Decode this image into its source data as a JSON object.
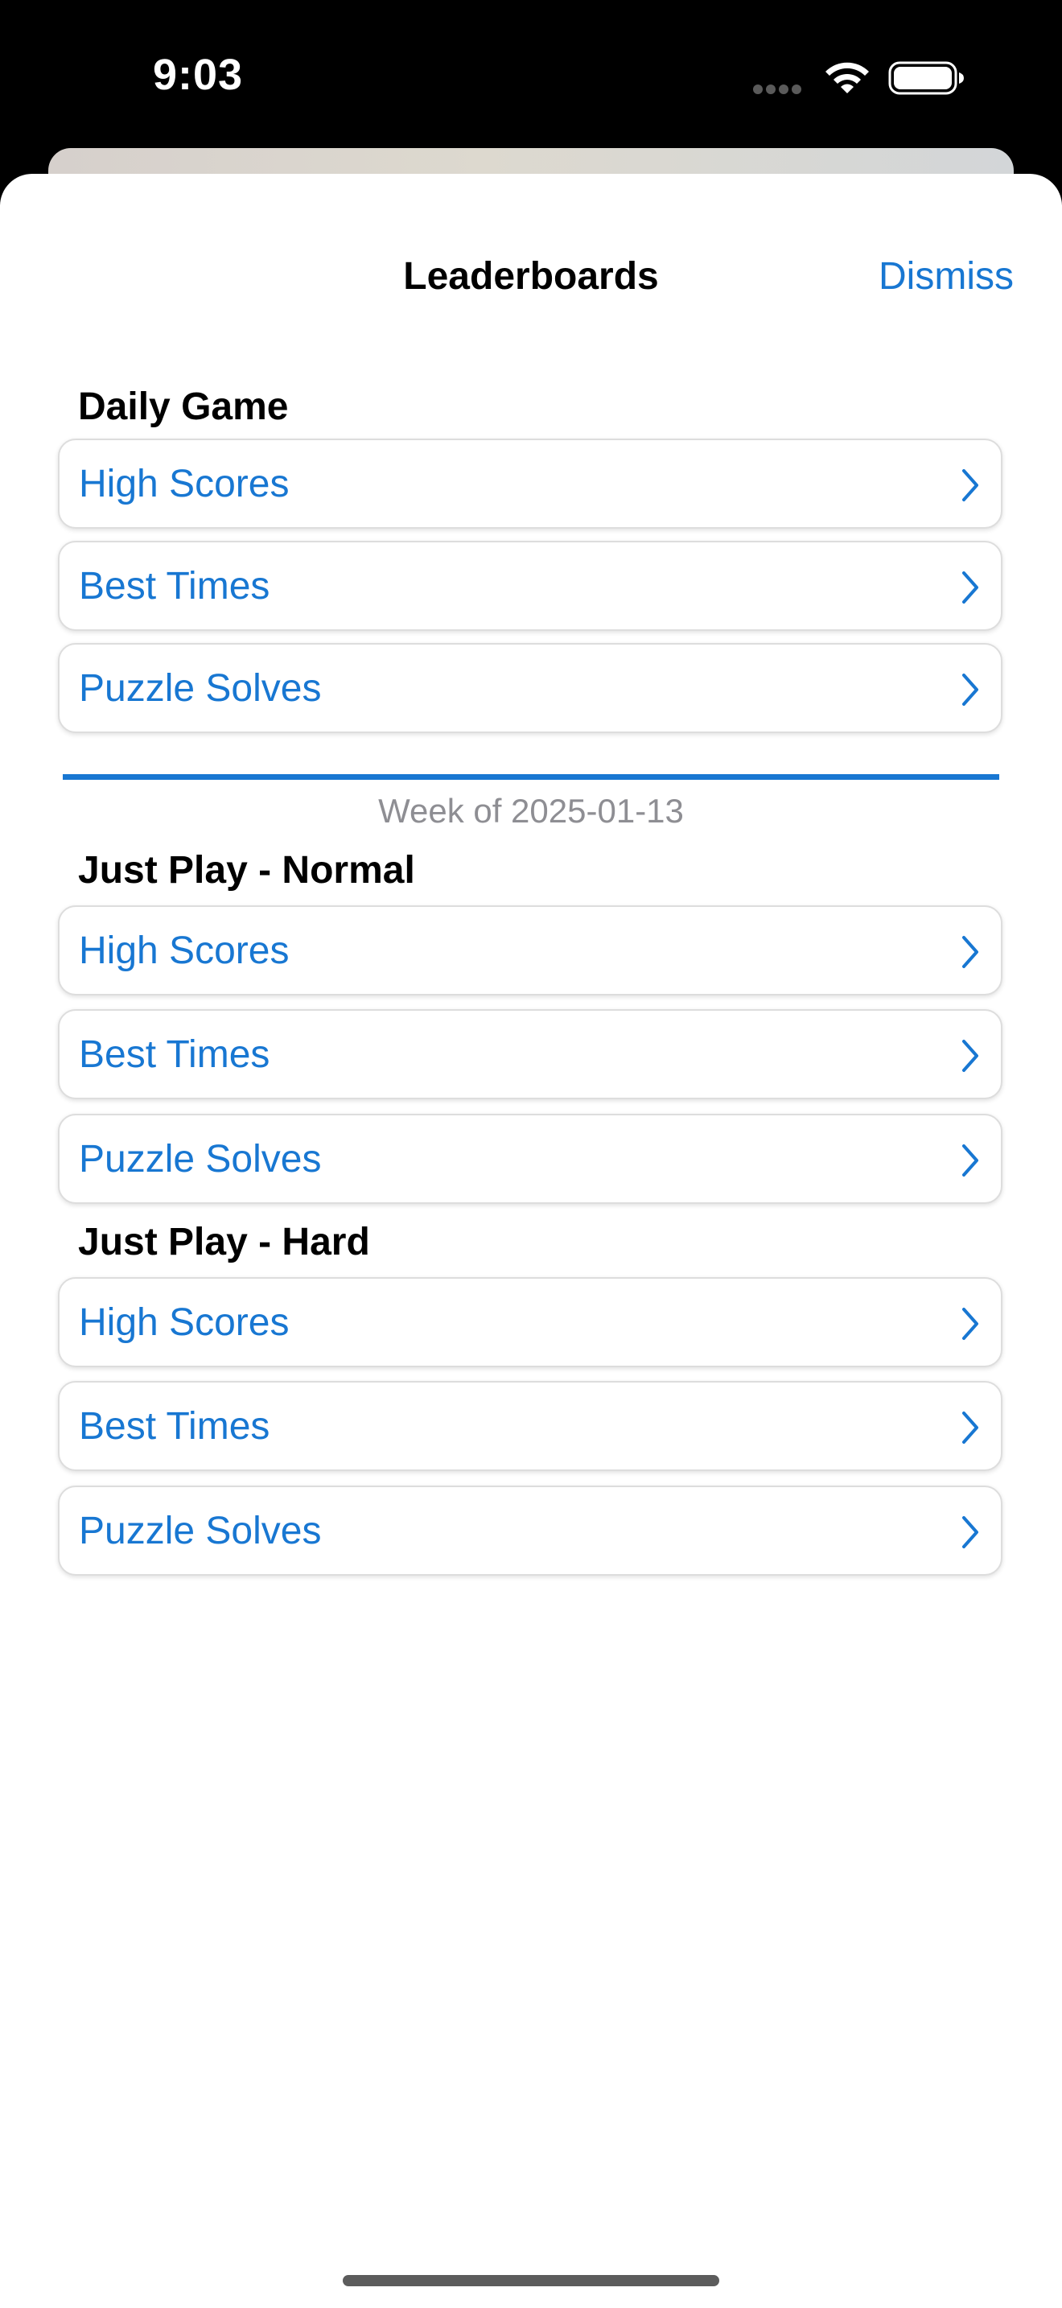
{
  "status_bar": {
    "time": "9:03"
  },
  "sheet": {
    "title": "Leaderboards",
    "dismiss_label": "Dismiss",
    "accent_color": "#1877d2"
  },
  "sections": [
    {
      "header": "Daily Game",
      "items": [
        {
          "label": "High Scores"
        },
        {
          "label": "Best Times"
        },
        {
          "label": "Puzzle Solves"
        }
      ]
    },
    {
      "header": "Just Play - Normal",
      "items": [
        {
          "label": "High Scores"
        },
        {
          "label": "Best Times"
        },
        {
          "label": "Puzzle Solves"
        }
      ]
    },
    {
      "header": "Just Play - Hard",
      "items": [
        {
          "label": "High Scores"
        },
        {
          "label": "Best Times"
        },
        {
          "label": "Puzzle Solves"
        }
      ]
    }
  ],
  "week_caption": "Week of 2025-01-13",
  "icons": {
    "row_disclosure": "chevron-right-icon",
    "wifi": "wifi-icon",
    "battery": "battery-icon",
    "cellular": "cellular-dots-icon"
  }
}
